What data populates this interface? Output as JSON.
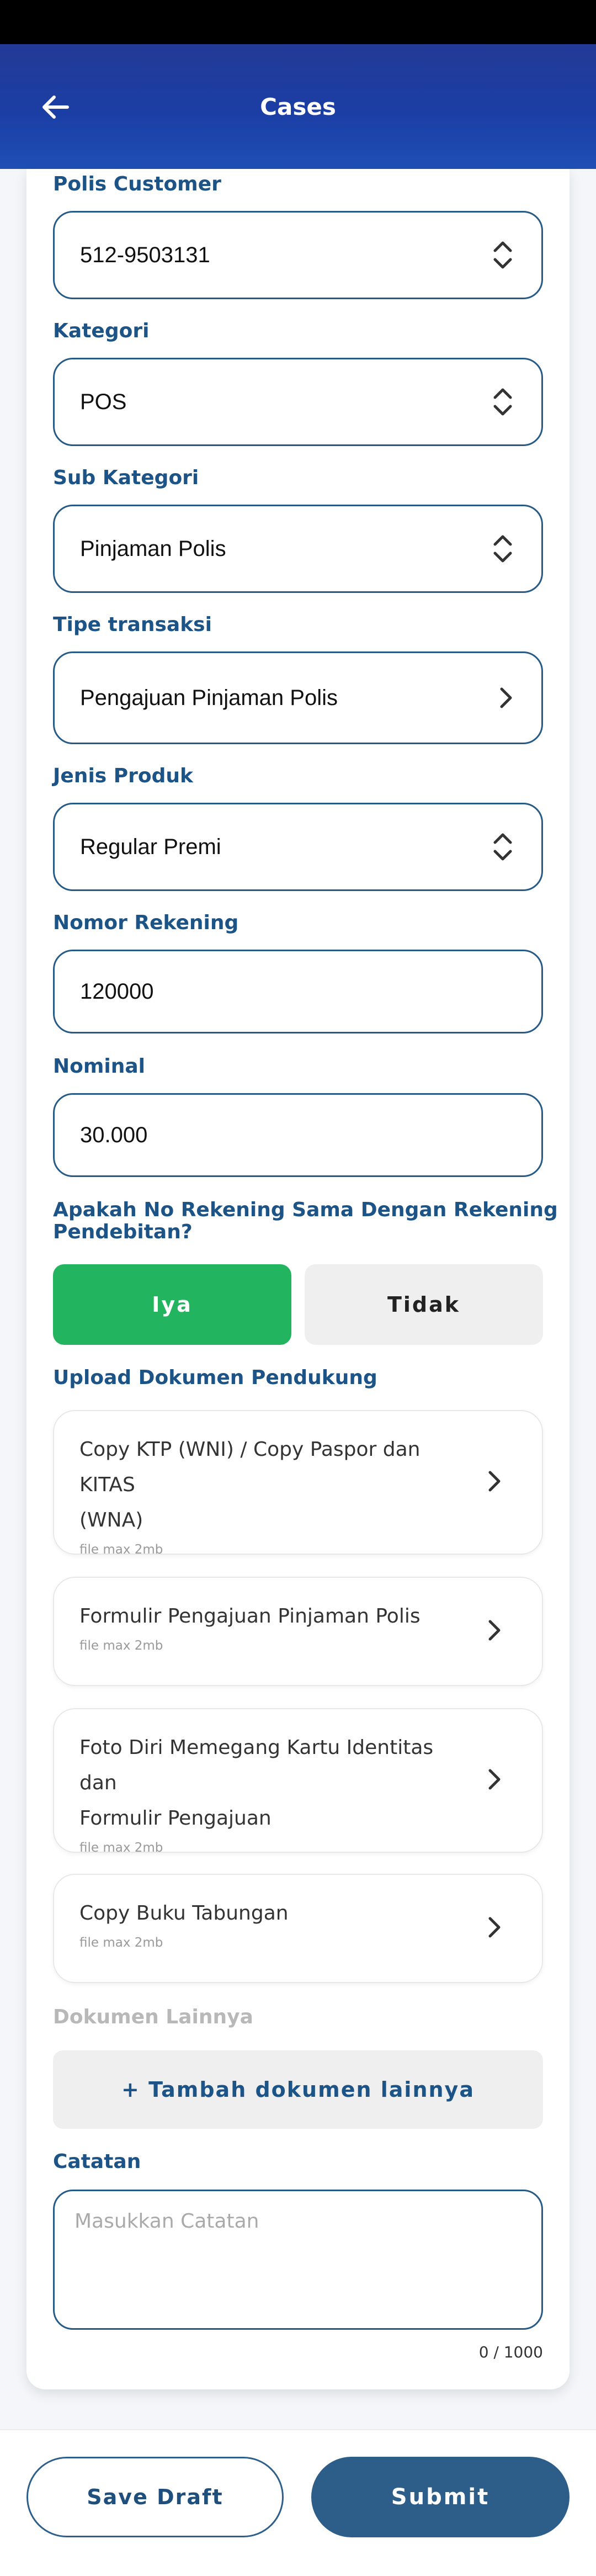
{
  "header": {
    "title": "Cases",
    "back_icon": "arrow-left-icon"
  },
  "form": {
    "polis_customer": {
      "label": "Polis Customer",
      "value": "512-9503131"
    },
    "kategori": {
      "label": "Kategori",
      "value": "POS"
    },
    "sub_kategori": {
      "label": "Sub Kategori",
      "value": "Pinjaman Polis"
    },
    "tipe_transaksi": {
      "label": "Tipe transaksi",
      "value": "Pengajuan Pinjaman Polis"
    },
    "jenis_produk": {
      "label": "Jenis Produk",
      "value": "Regular Premi"
    },
    "nomor_rekening": {
      "label": "Nomor Rekening",
      "value": "120000"
    },
    "nominal": {
      "label": "Nominal",
      "value": "30.000"
    },
    "same_account_question": {
      "label_line1": "Apakah No Rekening Sama Dengan Rekening",
      "label_line2": "Pendebitan?",
      "yes": "Iya",
      "no": "Tidak",
      "selected": "Iya"
    }
  },
  "upload": {
    "label": "Upload Dokumen Pendukung",
    "documents": [
      {
        "title_line1": "Copy KTP (WNI) / Copy Paspor dan KITAS",
        "title_line2": "(WNA)",
        "note": "file max 2mb"
      },
      {
        "title_line1": "Formulir Pengajuan Pinjaman Polis",
        "title_line2": "",
        "note": "file max 2mb"
      },
      {
        "title_line1": "Foto Diri Memegang Kartu Identitas dan",
        "title_line2": "Formulir Pengajuan",
        "note": "file max 2mb"
      },
      {
        "title_line1": "Copy Buku Tabungan",
        "title_line2": "",
        "note": "file max 2mb"
      }
    ]
  },
  "other_docs": {
    "label": "Dokumen Lainnya",
    "add_button": "+ Tambah dokumen lainnya"
  },
  "notes": {
    "label": "Catatan",
    "placeholder": "Masukkan Catatan",
    "counter": "0 / 1000"
  },
  "actions": {
    "save_draft": "Save Draft",
    "submit": "Submit"
  },
  "colors": {
    "header_blue": "#1b3ea5",
    "label_blue": "#1d5487",
    "field_border": "#275b86",
    "selected_green": "#22b45e",
    "submit_blue": "#2c5e89"
  }
}
